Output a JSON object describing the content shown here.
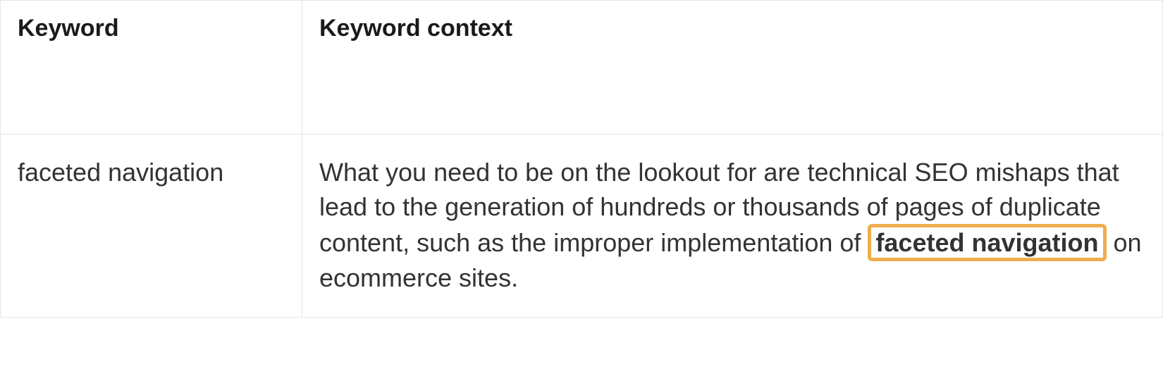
{
  "table": {
    "headers": {
      "col1": "Keyword",
      "col2": "Keyword context"
    },
    "row": {
      "keyword": "faceted navigation",
      "context_before": "What you need to be on the lookout for are technical SEO mishaps that lead to the generation of hundreds or thousands of pages of duplicate content, such as the improper implementation of ",
      "context_highlight": "faceted navigation",
      "context_after": " on ecommerce sites."
    }
  }
}
